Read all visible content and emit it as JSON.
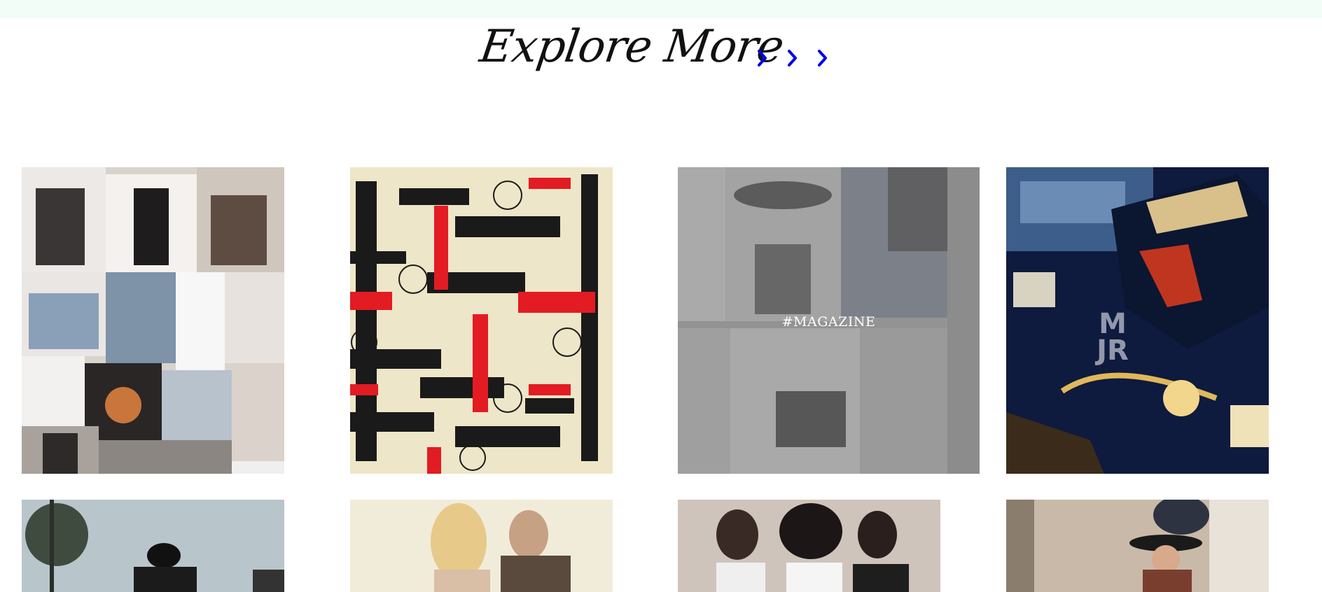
{
  "page": {
    "title": "Explore More"
  },
  "header": {
    "arrows": "right-chevron-icons"
  },
  "tiles": [
    {
      "id": "collage",
      "caption": ""
    },
    {
      "id": "fashion-typography",
      "caption": ""
    },
    {
      "id": "magazine",
      "caption": "#MAGAZINE"
    },
    {
      "id": "sneakers",
      "caption": "",
      "logo_line1": "M",
      "logo_line2": "JR"
    },
    {
      "id": "street",
      "caption": ""
    },
    {
      "id": "couple",
      "caption": ""
    },
    {
      "id": "group",
      "caption": ""
    },
    {
      "id": "city-hat",
      "caption": ""
    }
  ],
  "colors": {
    "accent": "#0000ee",
    "band": "#f1fdf6",
    "overlay": "#8c8c8c"
  }
}
